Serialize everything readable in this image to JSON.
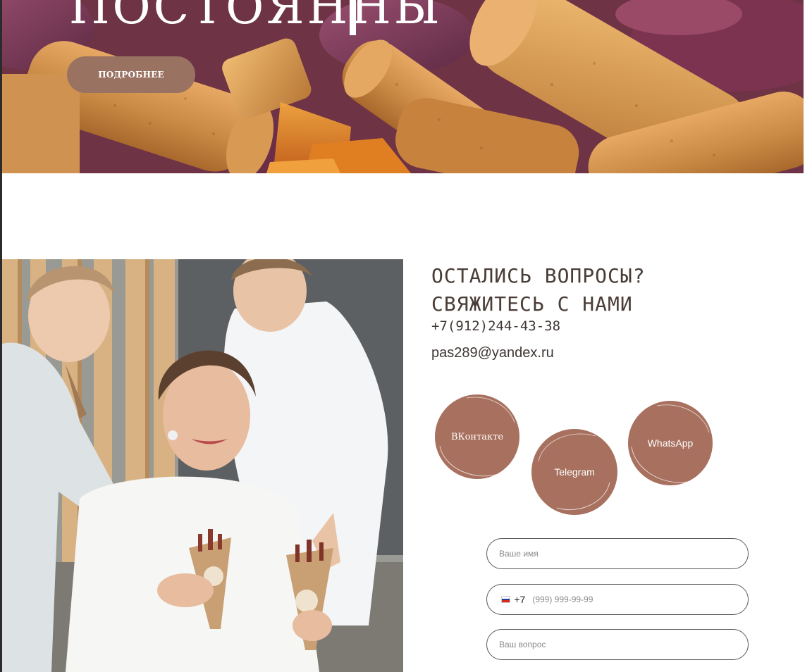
{
  "hero": {
    "title": "ПОСТОЯННЫ",
    "more_button": "ПОДРОБНЕЕ"
  },
  "contacts": {
    "title_line1": "Остались вопросы?",
    "title_line2": "Свяжитесь с нами",
    "phone": "+7(912)244-43-38",
    "email": "pas289@yandex.ru"
  },
  "social": {
    "vk": "ВКонтакте",
    "telegram": "Telegram",
    "whatsapp": "WhatsApp",
    "color": "#a8705e"
  },
  "form": {
    "name_placeholder": "Ваше имя",
    "phone_code": "+7",
    "phone_placeholder": "(999) 999-99-99",
    "question_placeholder": "Ваш вопрос",
    "country_flag": "russia-flag-icon"
  }
}
